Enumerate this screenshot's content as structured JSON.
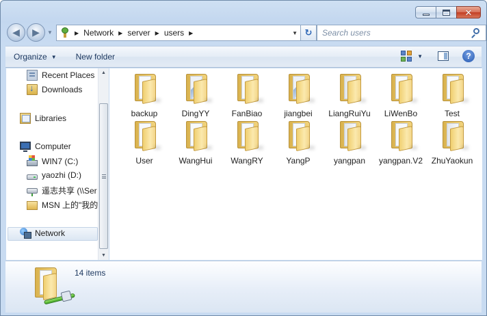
{
  "window": {
    "caption": {
      "minimize": "–",
      "maximize": "□",
      "close": "✕"
    }
  },
  "navigation": {
    "back": "◀",
    "forward": "▶",
    "breadcrumbs": [
      "Network",
      "server",
      "users"
    ],
    "search_placeholder": "Search users"
  },
  "toolbar": {
    "organize_label": "Organize",
    "new_folder_label": "New folder",
    "help_label": "?"
  },
  "sidebar": {
    "items": [
      {
        "label": "Recent Places",
        "icon": "recent-places-icon"
      },
      {
        "label": "Downloads",
        "icon": "downloads-folder-icon"
      },
      {
        "label": "Libraries",
        "icon": "libraries-icon"
      },
      {
        "label": "Computer",
        "icon": "computer-icon"
      },
      {
        "label": "WIN7 (C:)",
        "icon": "windows-drive-icon"
      },
      {
        "label": "yaozhi (D:)",
        "icon": "drive-icon"
      },
      {
        "label": "遥志共享 (\\\\Ser",
        "icon": "network-drive-icon"
      },
      {
        "label": "MSN 上的\"我的",
        "icon": "folder-icon"
      },
      {
        "label": "Network",
        "icon": "network-icon",
        "selected": true
      }
    ]
  },
  "content": {
    "folders": [
      {
        "name": "backup",
        "paper": "plain"
      },
      {
        "name": "DingYY",
        "paper": "pic"
      },
      {
        "name": "FanBiao",
        "paper": "plain"
      },
      {
        "name": "jiangbei",
        "paper": "pic"
      },
      {
        "name": "LiangRuiYu",
        "paper": "grey"
      },
      {
        "name": "LiWenBo",
        "paper": "plain"
      },
      {
        "name": "Test",
        "paper": "plain"
      },
      {
        "name": "User",
        "paper": "plain"
      },
      {
        "name": "WangHui",
        "paper": "plain"
      },
      {
        "name": "WangRY",
        "paper": "plain"
      },
      {
        "name": "YangP",
        "paper": "plain"
      },
      {
        "name": "yangpan",
        "paper": "grey"
      },
      {
        "name": "yangpan.V2",
        "paper": "plain"
      },
      {
        "name": "ZhuYaokun",
        "paper": "grey"
      }
    ]
  },
  "details": {
    "item_count": "14 items"
  },
  "colors": {
    "chrome": "#c8dbf1",
    "toolbar_text": "#1e3960",
    "folder": "#f0cf70"
  }
}
